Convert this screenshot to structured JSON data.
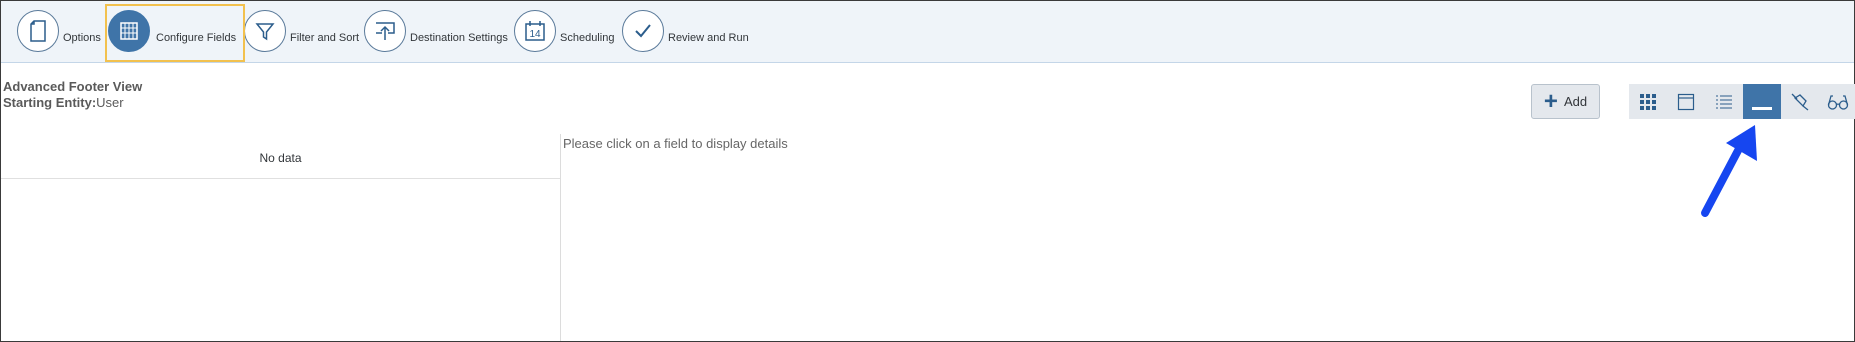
{
  "wizard": {
    "steps": [
      {
        "label": "Options",
        "icon": "document-icon"
      },
      {
        "label": "Configure Fields",
        "icon": "grid-icon",
        "active": true
      },
      {
        "label": "Filter and Sort",
        "icon": "filter-icon"
      },
      {
        "label": "Destination Settings",
        "icon": "upload-icon"
      },
      {
        "label": "Scheduling",
        "icon": "calendar-icon",
        "calendar_day": "14"
      },
      {
        "label": "Review and Run",
        "icon": "checkmark-icon"
      }
    ]
  },
  "view": {
    "title": "Advanced Footer View",
    "entity_label": "Starting Entity:",
    "entity_value": "User"
  },
  "toolbar": {
    "add_label": "Add",
    "view_buttons": [
      "grid-view-icon",
      "window-view-icon",
      "list-view-icon",
      "footer-view-icon",
      "pin-icon",
      "glasses-icon"
    ],
    "selected_view": "footer-view-icon"
  },
  "fields_panel": {
    "empty_text": "No data"
  },
  "details_panel": {
    "hint": "Please click on a field to display details"
  },
  "colors": {
    "accent": "#3f74a8",
    "highlight": "#f2c14e",
    "arrow": "#1646f0",
    "header_bg": "#eff4f9"
  }
}
